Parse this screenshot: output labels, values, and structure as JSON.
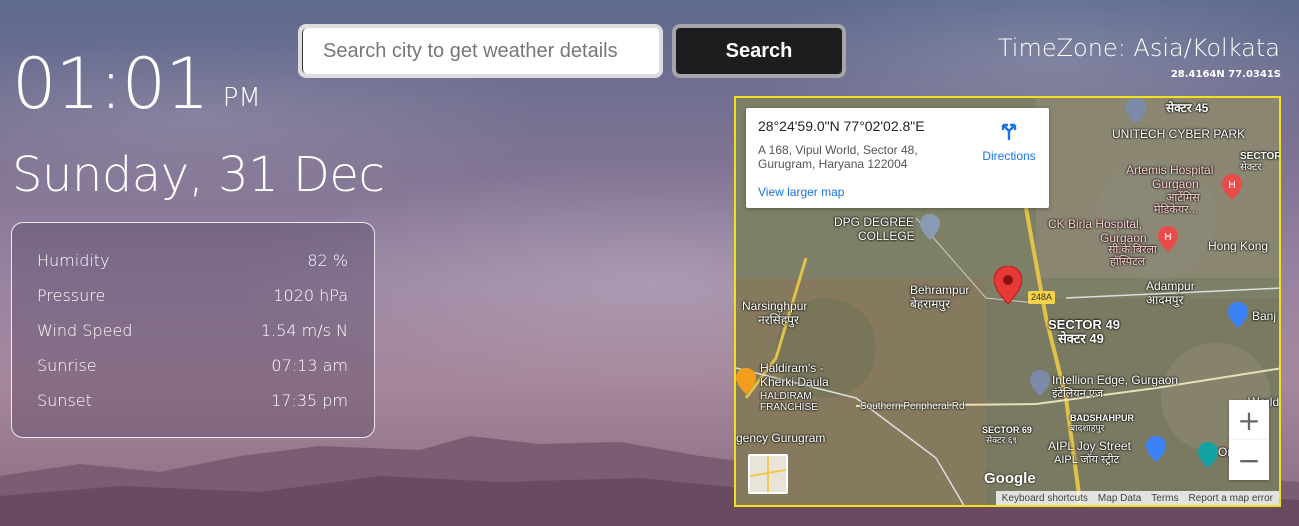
{
  "clock": {
    "time": "01:01",
    "ampm": "PM"
  },
  "date": "Sunday, 31 Dec",
  "weather": {
    "rows": [
      {
        "label": "Humidity",
        "value": "82 %"
      },
      {
        "label": "Pressure",
        "value": "1020 hPa"
      },
      {
        "label": "Wind Speed",
        "value": "1.54 m/s N"
      },
      {
        "label": "Sunrise",
        "value": "07:13 am"
      },
      {
        "label": "Sunset",
        "value": "17:35 pm"
      }
    ]
  },
  "search": {
    "placeholder": "Search city to get weather details",
    "button_label": "Search"
  },
  "timezone": {
    "label": "TimeZone: Asia/Kolkata",
    "coords": "28.4164N 77.0341S"
  },
  "map": {
    "info": {
      "coords": "28°24'59.0\"N 77°02'02.8\"E",
      "address_line1": "A 168, Vipul World, Sector 48,",
      "address_line2": "Gurugram, Haryana 122004",
      "view_larger": "View larger map",
      "directions": "Directions"
    },
    "places": {
      "sector45": "सेक्टर 45",
      "unitech": "UNITECH CYBER PARK",
      "artemis1": "Artemis Hospital",
      "artemis2": "Gurgaon",
      "artemis3": "आर्टेमिस",
      "artemis4": "मेडिकेयर...",
      "sector_tr": "SECTOR",
      "sector_tr2": "सेक्टर",
      "dpg1": "DPG DEGREE",
      "dpg2": "COLLEGE",
      "ckbirla1": "CK Birla Hospital,",
      "ckbirla2": "Gurgaon",
      "ckbirla3": "सी.के.बिरला",
      "ckbirla4": "हॉस्पिटल",
      "hongkong": "Hong Kong",
      "adampur1": "Adampur",
      "adampur2": "आदमपुर",
      "behrampur1": "Behrampur",
      "behrampur2": "बेहरामपुर",
      "road_248a": "248A",
      "narsinghpur1": "Narsinghpur",
      "narsinghpur2": "नरसिंहपुर",
      "sector49_1": "SECTOR 49",
      "sector49_2": "सेक्टर 49",
      "banj": "Banj",
      "haldiram1": "Haldiram's -",
      "haldiram2": "Kherki Daula",
      "haldiram3": "HALDIRAM",
      "haldiram4": "FRANCHISE",
      "intellion1": "Intellion Edge, Gurgaon",
      "intellion2": "इंटेलियन एज",
      "spr": "Southern Peripheral Rd",
      "badshahpur1": "BADSHAHPUR",
      "badshahpur2": "बादशाहपुर",
      "world": "World",
      "gency": "gency Gurugram",
      "sector69_1": "SECTOR 69",
      "sector69_2": "सेक्टर ६९",
      "aipl1": "AIPL Joy Street",
      "aipl2": "AIPL जॉय स्ट्रीट",
      "om": "Om"
    },
    "zoom_in": "+",
    "zoom_out": "−",
    "google": "Google",
    "attribution": [
      "Keyboard shortcuts",
      "Map Data",
      "Terms",
      "Report a map error"
    ]
  }
}
